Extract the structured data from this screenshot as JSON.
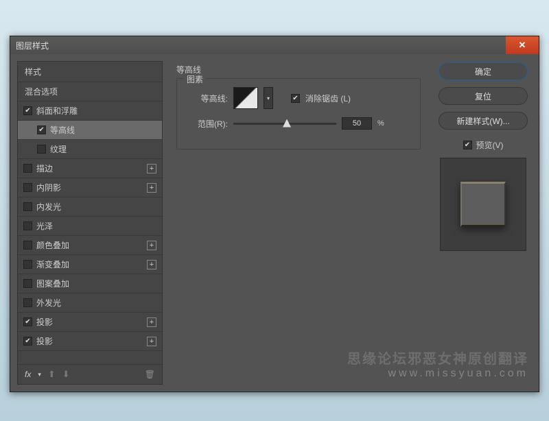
{
  "dialog": {
    "title": "图层样式"
  },
  "styles": {
    "header": "样式",
    "blend_options": "混合选项",
    "items": [
      {
        "label": "斜面和浮雕",
        "checked": true,
        "indent": false,
        "plus": false
      },
      {
        "label": "等高线",
        "checked": true,
        "indent": true,
        "plus": false,
        "selected": true
      },
      {
        "label": "纹理",
        "checked": false,
        "indent": true,
        "plus": false
      },
      {
        "label": "描边",
        "checked": false,
        "indent": false,
        "plus": true
      },
      {
        "label": "内阴影",
        "checked": false,
        "indent": false,
        "plus": true
      },
      {
        "label": "内发光",
        "checked": false,
        "indent": false,
        "plus": false
      },
      {
        "label": "光泽",
        "checked": false,
        "indent": false,
        "plus": false
      },
      {
        "label": "颜色叠加",
        "checked": false,
        "indent": false,
        "plus": true
      },
      {
        "label": "渐变叠加",
        "checked": false,
        "indent": false,
        "plus": true
      },
      {
        "label": "图案叠加",
        "checked": false,
        "indent": false,
        "plus": false
      },
      {
        "label": "外发光",
        "checked": false,
        "indent": false,
        "plus": false
      },
      {
        "label": "投影",
        "checked": true,
        "indent": false,
        "plus": true
      },
      {
        "label": "投影",
        "checked": true,
        "indent": false,
        "plus": true
      }
    ],
    "footer_fx": "fx"
  },
  "settings": {
    "section_title": "等高线",
    "fieldset_title": "图素",
    "contour_label": "等高线:",
    "antialias_label": "消除锯齿 (L)",
    "antialias_checked": true,
    "range_label": "范围(R):",
    "range_value": "50",
    "range_unit": "%"
  },
  "actions": {
    "ok": "确定",
    "cancel": "复位",
    "new_style": "新建样式(W)...",
    "preview_label": "预览(V)",
    "preview_checked": true
  },
  "watermark": {
    "line1": "思缘论坛邪恶女神原创翻译",
    "line2": "www.missyuan.com"
  }
}
